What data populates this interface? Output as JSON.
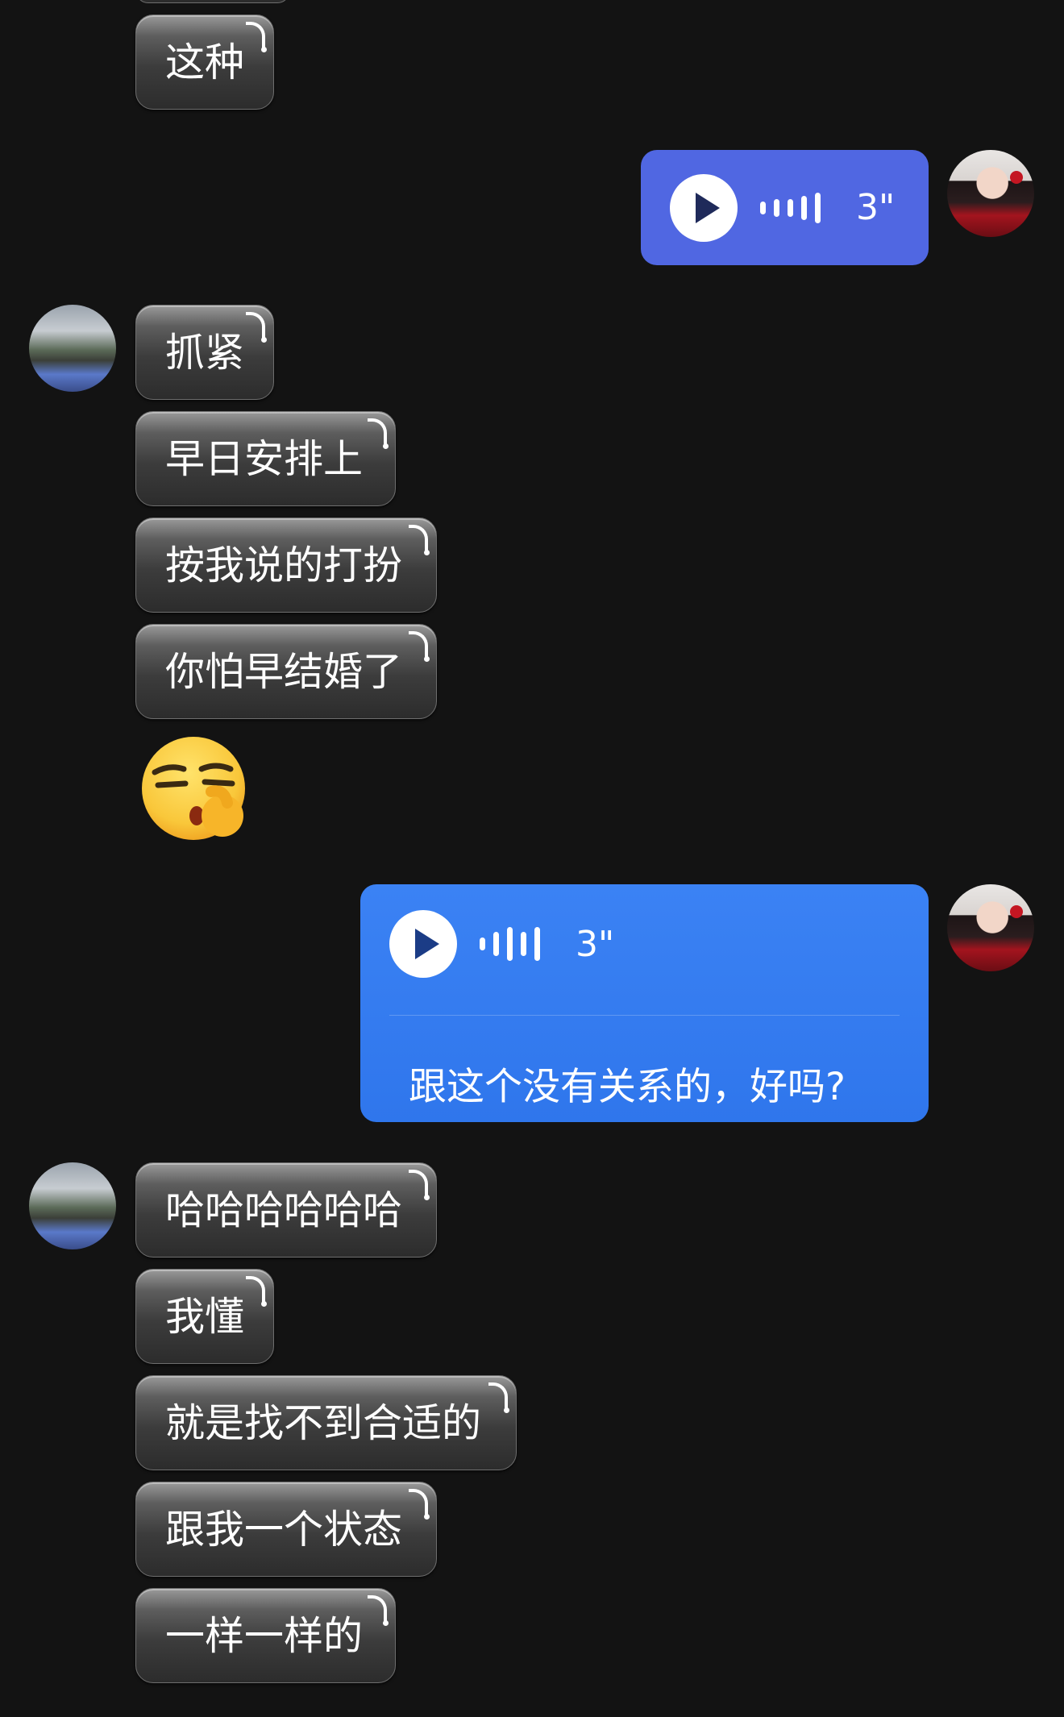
{
  "partner_messages_1": [
    {
      "text": "这种"
    }
  ],
  "self_voice_1": {
    "duration": "3\""
  },
  "partner_messages_2": [
    {
      "text": "抓紧"
    },
    {
      "text": "早日安排上"
    },
    {
      "text": "按我说的打扮"
    },
    {
      "text": "你怕早结婚了"
    }
  ],
  "emoji_sticker": "shushing-thinking-emoji",
  "self_voice_2": {
    "duration": "3\"",
    "transcript": "跟这个没有关系的，好吗?"
  },
  "partner_messages_3": [
    {
      "text": "哈哈哈哈哈哈"
    },
    {
      "text": "我懂"
    },
    {
      "text": "就是找不到合适的"
    },
    {
      "text": "跟我一个状态"
    },
    {
      "text": "一样一样的"
    }
  ],
  "colors": {
    "background": "#131313",
    "voice_short_bubble": "#5067e2",
    "voice_long_bubble": "#3b82f4"
  }
}
